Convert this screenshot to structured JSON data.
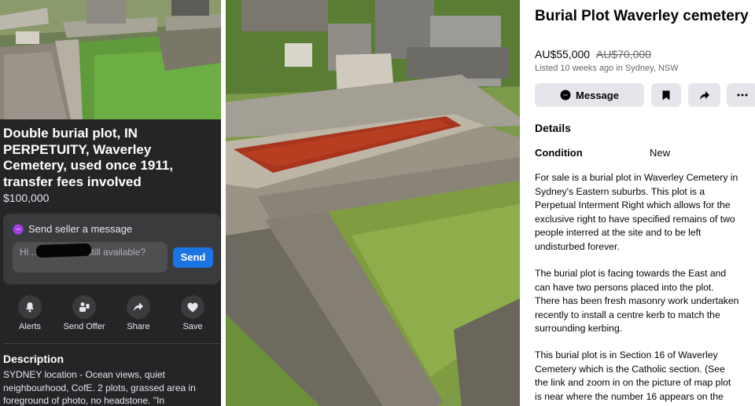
{
  "left_listing": {
    "title": "Double burial plot, IN PERPETUITY,  Waverley Cemetery, used once 1911, transfer fees involved",
    "price": "$100,000",
    "message": {
      "header": "Send seller a message",
      "input_value": "Hi          ...tom, is this still available?",
      "send_label": "Send"
    },
    "actions": [
      {
        "label": "Alerts",
        "icon": "bell-icon"
      },
      {
        "label": "Send Offer",
        "icon": "send-offer-icon"
      },
      {
        "label": "Share",
        "icon": "share-icon"
      },
      {
        "label": "Save",
        "icon": "heart-icon"
      }
    ],
    "description_heading": "Description",
    "description_text": "SYDNEY location - Ocean views, quiet neighbourhood, CofE. 2 plots, grassed area in foreground of photo, no headstone.  \"In"
  },
  "right_listing": {
    "title": "Burial Plot Waverley cemetery",
    "price": "AU$55,000",
    "original_price": "AU$70,000",
    "listed": "Listed 10 weeks ago in Sydney, NSW",
    "buttons": {
      "message_label": "Message",
      "save_icon": "bookmark-icon",
      "share_icon": "share-icon",
      "more_icon": "more-icon"
    },
    "details_heading": "Details",
    "condition_label": "Condition",
    "condition_value": "New",
    "paragraphs": [
      "For sale is a burial plot in Waverley Cemetery in\nSydney's Eastern suburbs. This plot is a\nPerpetual Interment Right which allows for the\nexclusive right to have specified remains of two\npeople interred at the site and to be left\nundisturbed forever.",
      "The burial plot is facing towards the East and\ncan have two persons placed into the plot.\nThere has been fresh masonry work undertaken\nrecently to install a centre kerb to match the\nsurrounding kerbing.",
      "This burial plot is in Section 16 of Waverley\nCemetery which is the Catholic section. (See\nthe link and zoom in on the picture of map plot\nis near where the number 16 appears on the"
    ]
  },
  "colors": {
    "dark_bg": "#242526",
    "card_bg": "#3a3b3c",
    "accent_blue": "#1b74e4",
    "light_button": "#e4e6eb",
    "muted_text": "#65676b"
  }
}
